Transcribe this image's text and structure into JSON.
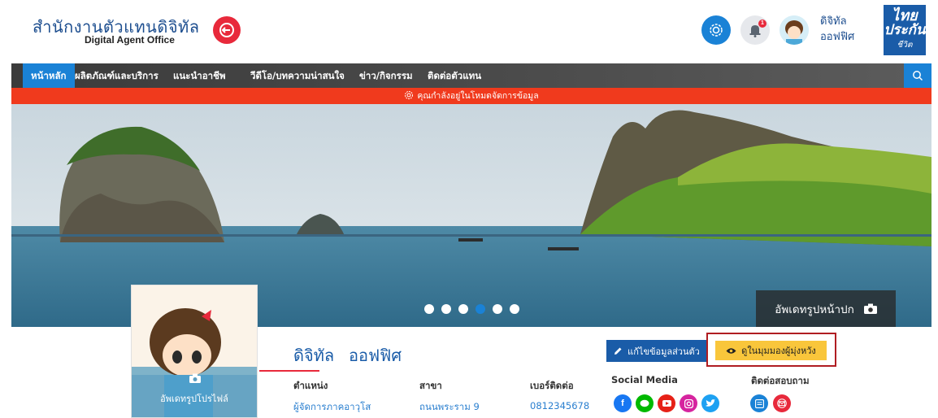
{
  "header": {
    "brand_th": "สำนักงานตัวแทนดิจิทัล",
    "brand_en": "Digital Agent Office",
    "user_first": "ดิจิทัล",
    "user_last": "ออฟฟิศ",
    "notification_count": "1",
    "logo": {
      "line1": "ไทย",
      "line2": "ประกัน",
      "line3": "ชีวิต"
    },
    "icons": [
      "logout-icon",
      "gear-icon",
      "bell-icon",
      "avatar-icon"
    ]
  },
  "nav": {
    "items": [
      {
        "label": "หน้าหลัก",
        "active": true
      },
      {
        "label": "ผลิตภัณฑ์และบริการ",
        "active": false
      },
      {
        "label": "แนะนำอาชีพ",
        "active": false
      },
      {
        "label": "วีดีโอ/บทความน่าสนใจ",
        "active": false
      },
      {
        "label": "ข่าว/กิจกรรม",
        "active": false
      },
      {
        "label": "ติดต่อตัวแทน",
        "active": false
      }
    ]
  },
  "alert": {
    "text": "คุณกำลังอยู่ในโหมดจัดการข้อมูล"
  },
  "hero": {
    "slide_count": 6,
    "active_slide": 4,
    "update_cover_label": "อัพเดทรูปหน้าปก"
  },
  "profile": {
    "update_profile_label": "อัพเดทรูปโปรไฟล์",
    "first_name": "ดิจิทัล",
    "last_name": "ออฟฟิศ",
    "position_label": "ตำแหน่ง",
    "position_value": "ผู้จัดการภาคอาวุโส",
    "branch_label": "สาขา",
    "branch_value": "ถนนพระราม 9",
    "phone_label": "เบอร์ติดต่อ",
    "phone_value": "0812345678"
  },
  "actions": {
    "edit_label": "แก้ไขข้อมูลส่วนตัว",
    "view_label": "ดูในมุมมองผู้มุ่งหวัง"
  },
  "social": {
    "heading": "Social Media",
    "contact_heading": "ติดต่อสอบถาม",
    "colors": {
      "facebook": "#1877f2",
      "line": "#00b900",
      "youtube": "#e62117",
      "instagram": "#d6249f",
      "twitter": "#1da1f2",
      "message": "#1a82d6",
      "email": "#e8293b"
    }
  }
}
